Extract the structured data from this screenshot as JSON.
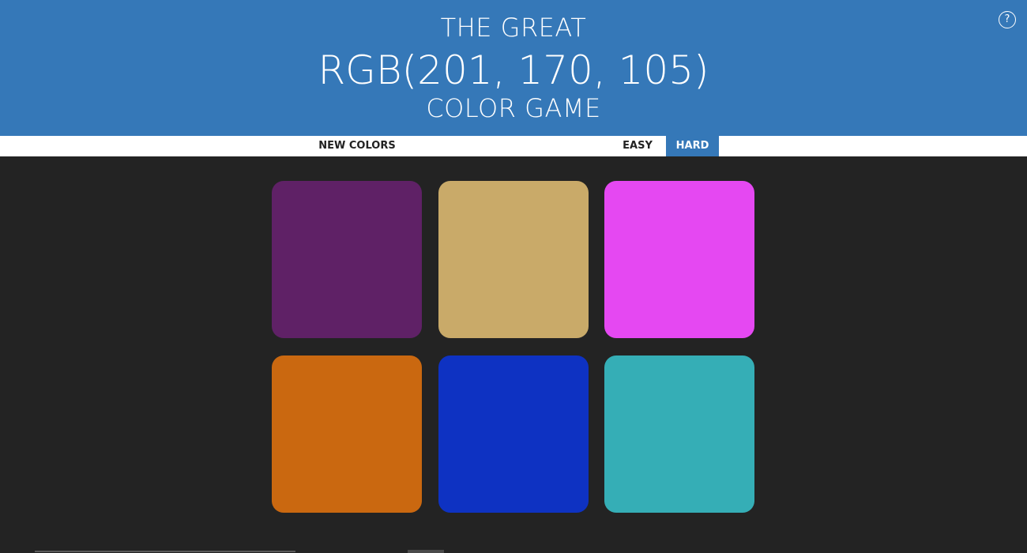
{
  "header": {
    "line1": "THE GREAT",
    "color_display": "RGB(201, 170, 105)",
    "line3": "COLOR GAME",
    "background": "#3578b8",
    "help_label": "?"
  },
  "stripe": {
    "new_colors_label": "NEW COLORS",
    "message": "",
    "easy_label": "EASY",
    "hard_label": "HARD",
    "selected_mode": "HARD"
  },
  "board": {
    "background": "#232323",
    "squares": [
      {
        "color": "#5f2166"
      },
      {
        "color": "#c9aa69"
      },
      {
        "color": "#e548f2"
      },
      {
        "color": "#ca6810"
      },
      {
        "color": "#0e32c2"
      },
      {
        "color": "#35aeb6"
      }
    ]
  }
}
